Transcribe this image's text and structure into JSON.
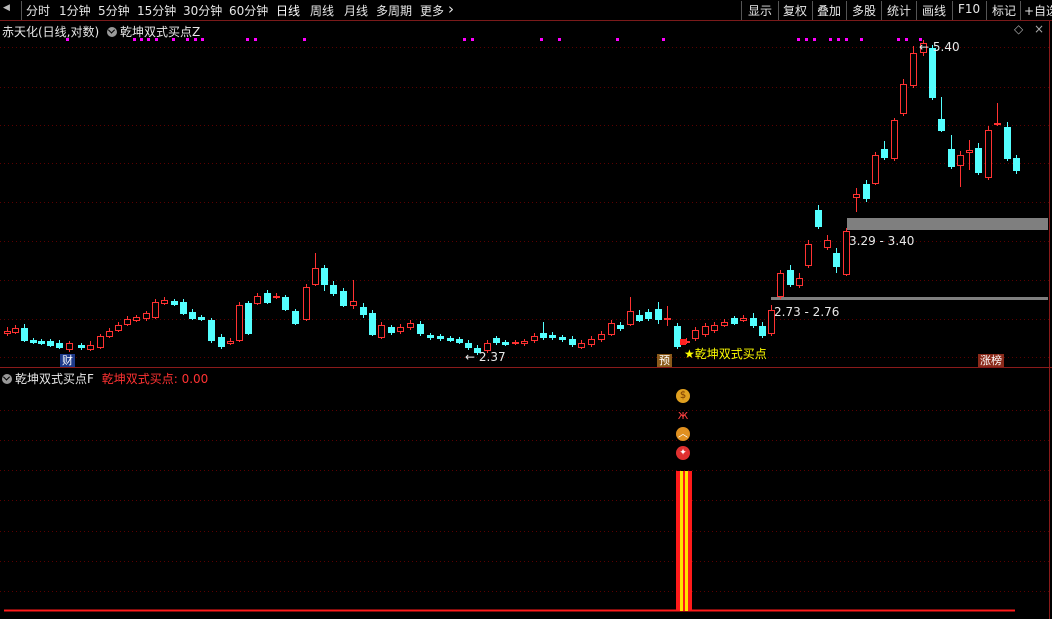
{
  "toolbar": {
    "periods": [
      "分时",
      "1分钟",
      "5分钟",
      "15分钟",
      "30分钟",
      "60分钟",
      "日线",
      "周线",
      "月线",
      "多周期",
      "更多"
    ],
    "active_period": "日线",
    "more_chevron": "›",
    "right_buttons": [
      "显示",
      "复权",
      "叠加",
      "多股",
      "统计",
      "画线",
      "F10",
      "标记",
      "+自选"
    ]
  },
  "main_panel": {
    "stock_title": "赤天化(日线,对数)",
    "indicator_name": "乾坤双式买点Z",
    "price_labels": {
      "high": "5.40",
      "low": "2.37",
      "zone_upper": "3.29 - 3.40",
      "zone_lower": "2.73 - 2.76"
    },
    "signal_text": "乾坤双式买点",
    "badges": [
      "财",
      "预",
      "涨榜"
    ]
  },
  "sub_panel": {
    "title": "乾坤双式买点F",
    "value_label": "乾坤双式买点: 0.00"
  },
  "colors": {
    "up": "#ff3232",
    "down": "#54ffff",
    "grid": "#5a0000",
    "zone": "#7f7f7f",
    "magenta": "#ff00ff",
    "signal": "#ffff00"
  },
  "icons": [
    "triangle-left-icon",
    "triangle-right-icon",
    "collapse-circle-icon",
    "star-icon",
    "money-bag-icon",
    "butterfly-icon",
    "chevron-up-icon",
    "signal-badge-icon"
  ]
}
